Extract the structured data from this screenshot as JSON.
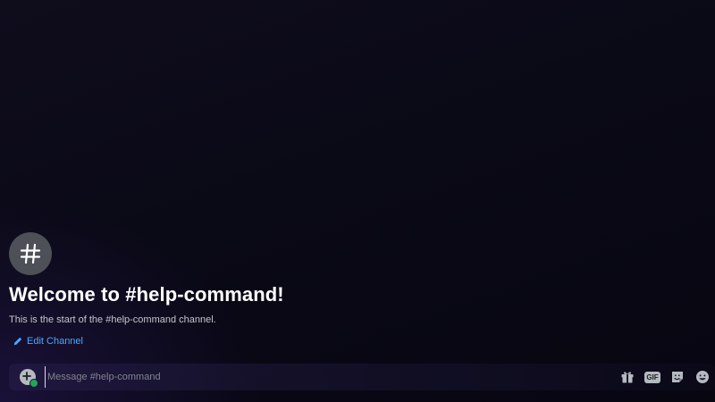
{
  "channel": {
    "avatar_icon": "hashtag-icon",
    "welcome_title": "Welcome to #help-command!",
    "start_text": "This is the start of the #help-command channel.",
    "edit_label": "Edit Channel",
    "edit_icon": "pencil-icon"
  },
  "composer": {
    "placeholder": "Message #help-command",
    "attach_icon": "plus-circle-icon",
    "status_color": "#23a55a",
    "tools": [
      {
        "name": "gift-icon"
      },
      {
        "name": "gif-icon",
        "label": "GIF"
      },
      {
        "name": "sticker-icon"
      },
      {
        "name": "emoji-icon"
      }
    ]
  },
  "colors": {
    "accent_link": "#4aa8ff",
    "avatar_bg": "#4e5058"
  }
}
